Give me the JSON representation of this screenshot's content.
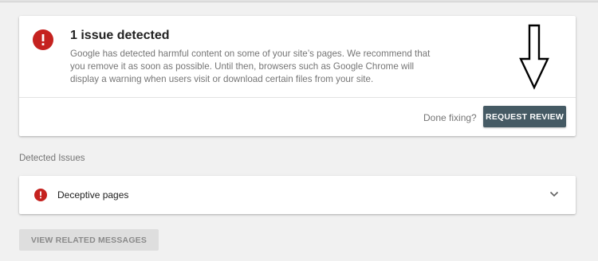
{
  "issue_card": {
    "title": "1 issue detected",
    "description": "Google has detected harmful content on some of your site’s pages. We recommend that you remove it as soon as possible. Until then, browsers such as Google Chrome will display a warning when users visit or download certain files from your site.",
    "icon": "error-icon",
    "done_label": "Done fixing?",
    "review_button": "REQUEST REVIEW"
  },
  "detected_issues": {
    "section_label": "Detected Issues",
    "items": [
      {
        "label": "Deceptive pages",
        "icon": "error-icon",
        "expand_icon": "chevron-down-icon"
      }
    ]
  },
  "footer": {
    "related_button": "VIEW RELATED MESSAGES"
  },
  "colors": {
    "error": "#c5221f",
    "primary_button": "#455a64",
    "disabled_button": "#dedede",
    "background": "#f1f1f1"
  }
}
